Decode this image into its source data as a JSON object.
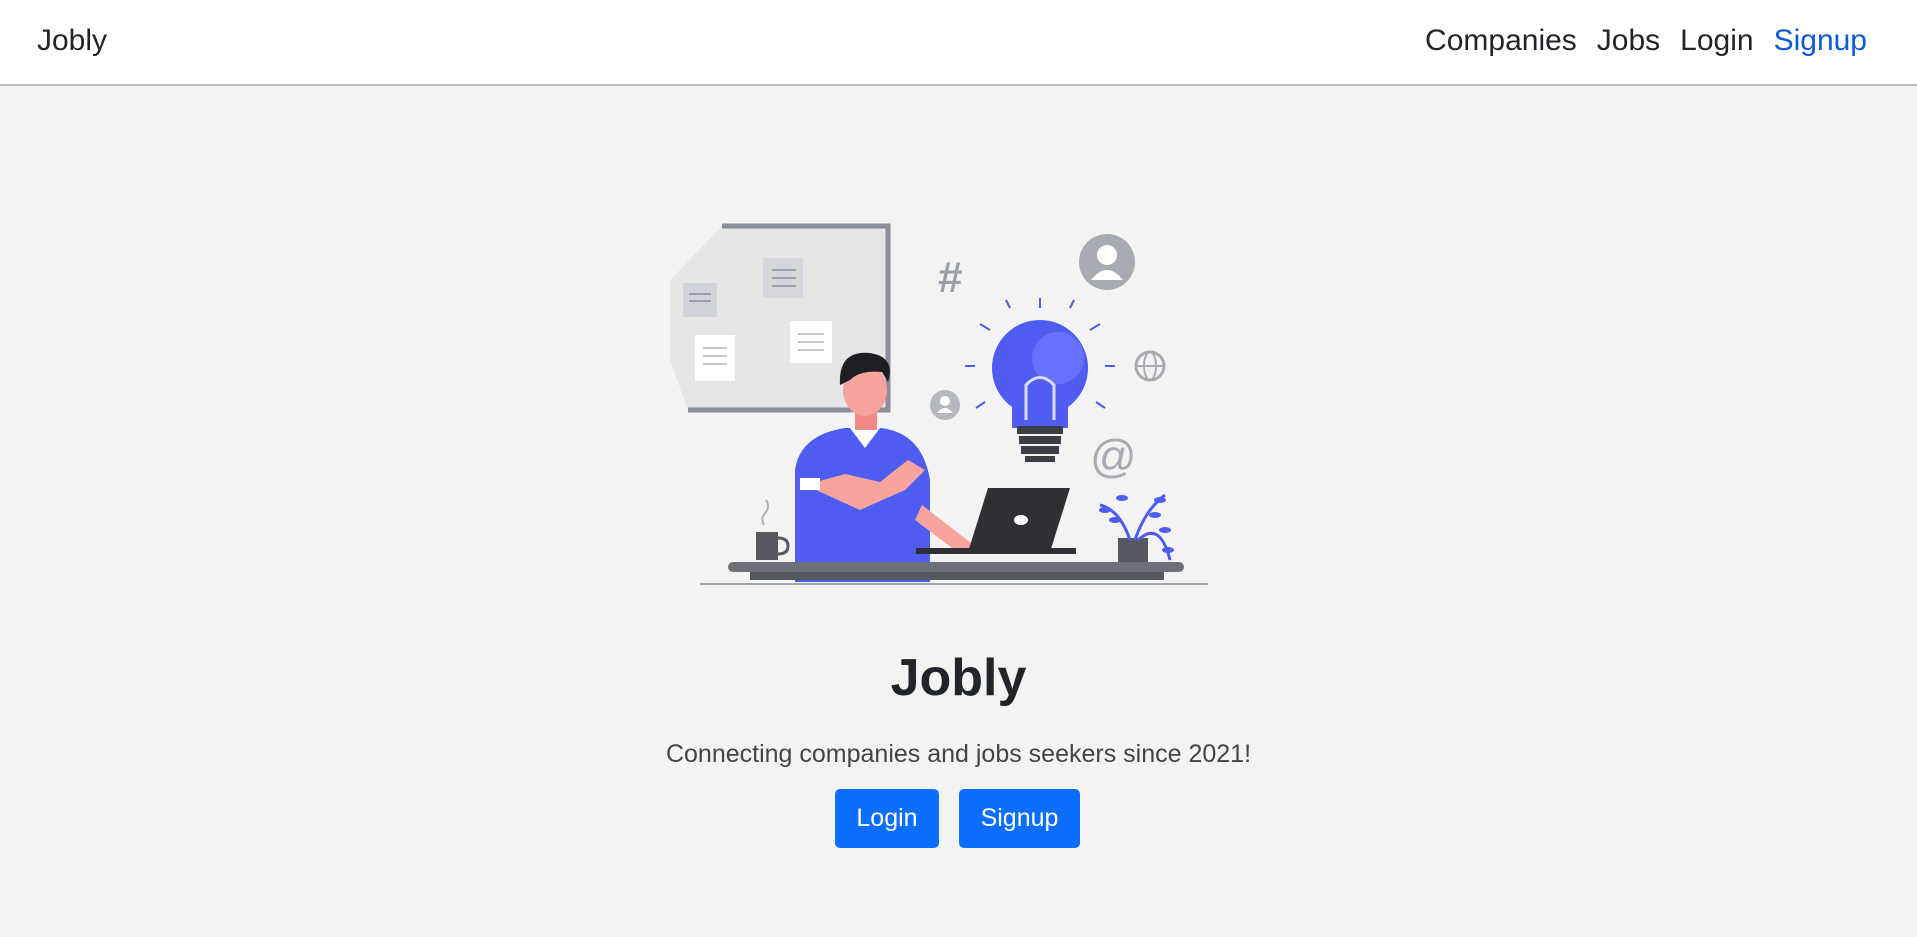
{
  "navbar": {
    "brand": "Jobly",
    "links": [
      {
        "label": "Companies"
      },
      {
        "label": "Jobs"
      },
      {
        "label": "Login"
      },
      {
        "label": "Signup"
      }
    ]
  },
  "hero": {
    "title": "Jobly",
    "tagline": "Connecting companies and jobs seekers since 2021!",
    "login_label": "Login",
    "signup_label": "Signup",
    "illustration_icons": [
      "idea-lightbulb-icon",
      "hashtag-icon",
      "at-sign-icon",
      "globe-icon",
      "user-avatar-icon",
      "laptop-icon",
      "coffee-mug-icon",
      "plant-icon",
      "bulletin-board-icon"
    ]
  },
  "colors": {
    "accent": "#0d6efd",
    "active_link": "#0d5bd6",
    "illustration_blue": "#4f5cf0",
    "background": "#f3f3f3"
  }
}
